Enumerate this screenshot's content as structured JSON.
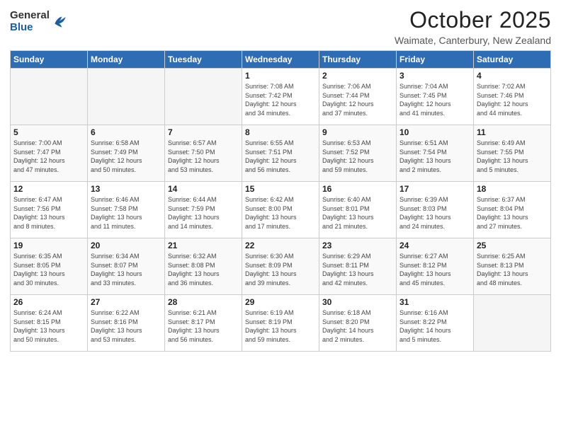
{
  "logo": {
    "general": "General",
    "blue": "Blue"
  },
  "header": {
    "title": "October 2025",
    "location": "Waimate, Canterbury, New Zealand"
  },
  "weekdays": [
    "Sunday",
    "Monday",
    "Tuesday",
    "Wednesday",
    "Thursday",
    "Friday",
    "Saturday"
  ],
  "weeks": [
    [
      {
        "day": "",
        "info": ""
      },
      {
        "day": "",
        "info": ""
      },
      {
        "day": "",
        "info": ""
      },
      {
        "day": "1",
        "info": "Sunrise: 7:08 AM\nSunset: 7:42 PM\nDaylight: 12 hours\nand 34 minutes."
      },
      {
        "day": "2",
        "info": "Sunrise: 7:06 AM\nSunset: 7:44 PM\nDaylight: 12 hours\nand 37 minutes."
      },
      {
        "day": "3",
        "info": "Sunrise: 7:04 AM\nSunset: 7:45 PM\nDaylight: 12 hours\nand 41 minutes."
      },
      {
        "day": "4",
        "info": "Sunrise: 7:02 AM\nSunset: 7:46 PM\nDaylight: 12 hours\nand 44 minutes."
      }
    ],
    [
      {
        "day": "5",
        "info": "Sunrise: 7:00 AM\nSunset: 7:47 PM\nDaylight: 12 hours\nand 47 minutes."
      },
      {
        "day": "6",
        "info": "Sunrise: 6:58 AM\nSunset: 7:49 PM\nDaylight: 12 hours\nand 50 minutes."
      },
      {
        "day": "7",
        "info": "Sunrise: 6:57 AM\nSunset: 7:50 PM\nDaylight: 12 hours\nand 53 minutes."
      },
      {
        "day": "8",
        "info": "Sunrise: 6:55 AM\nSunset: 7:51 PM\nDaylight: 12 hours\nand 56 minutes."
      },
      {
        "day": "9",
        "info": "Sunrise: 6:53 AM\nSunset: 7:52 PM\nDaylight: 12 hours\nand 59 minutes."
      },
      {
        "day": "10",
        "info": "Sunrise: 6:51 AM\nSunset: 7:54 PM\nDaylight: 13 hours\nand 2 minutes."
      },
      {
        "day": "11",
        "info": "Sunrise: 6:49 AM\nSunset: 7:55 PM\nDaylight: 13 hours\nand 5 minutes."
      }
    ],
    [
      {
        "day": "12",
        "info": "Sunrise: 6:47 AM\nSunset: 7:56 PM\nDaylight: 13 hours\nand 8 minutes."
      },
      {
        "day": "13",
        "info": "Sunrise: 6:46 AM\nSunset: 7:58 PM\nDaylight: 13 hours\nand 11 minutes."
      },
      {
        "day": "14",
        "info": "Sunrise: 6:44 AM\nSunset: 7:59 PM\nDaylight: 13 hours\nand 14 minutes."
      },
      {
        "day": "15",
        "info": "Sunrise: 6:42 AM\nSunset: 8:00 PM\nDaylight: 13 hours\nand 17 minutes."
      },
      {
        "day": "16",
        "info": "Sunrise: 6:40 AM\nSunset: 8:01 PM\nDaylight: 13 hours\nand 21 minutes."
      },
      {
        "day": "17",
        "info": "Sunrise: 6:39 AM\nSunset: 8:03 PM\nDaylight: 13 hours\nand 24 minutes."
      },
      {
        "day": "18",
        "info": "Sunrise: 6:37 AM\nSunset: 8:04 PM\nDaylight: 13 hours\nand 27 minutes."
      }
    ],
    [
      {
        "day": "19",
        "info": "Sunrise: 6:35 AM\nSunset: 8:05 PM\nDaylight: 13 hours\nand 30 minutes."
      },
      {
        "day": "20",
        "info": "Sunrise: 6:34 AM\nSunset: 8:07 PM\nDaylight: 13 hours\nand 33 minutes."
      },
      {
        "day": "21",
        "info": "Sunrise: 6:32 AM\nSunset: 8:08 PM\nDaylight: 13 hours\nand 36 minutes."
      },
      {
        "day": "22",
        "info": "Sunrise: 6:30 AM\nSunset: 8:09 PM\nDaylight: 13 hours\nand 39 minutes."
      },
      {
        "day": "23",
        "info": "Sunrise: 6:29 AM\nSunset: 8:11 PM\nDaylight: 13 hours\nand 42 minutes."
      },
      {
        "day": "24",
        "info": "Sunrise: 6:27 AM\nSunset: 8:12 PM\nDaylight: 13 hours\nand 45 minutes."
      },
      {
        "day": "25",
        "info": "Sunrise: 6:25 AM\nSunset: 8:13 PM\nDaylight: 13 hours\nand 48 minutes."
      }
    ],
    [
      {
        "day": "26",
        "info": "Sunrise: 6:24 AM\nSunset: 8:15 PM\nDaylight: 13 hours\nand 50 minutes."
      },
      {
        "day": "27",
        "info": "Sunrise: 6:22 AM\nSunset: 8:16 PM\nDaylight: 13 hours\nand 53 minutes."
      },
      {
        "day": "28",
        "info": "Sunrise: 6:21 AM\nSunset: 8:17 PM\nDaylight: 13 hours\nand 56 minutes."
      },
      {
        "day": "29",
        "info": "Sunrise: 6:19 AM\nSunset: 8:19 PM\nDaylight: 13 hours\nand 59 minutes."
      },
      {
        "day": "30",
        "info": "Sunrise: 6:18 AM\nSunset: 8:20 PM\nDaylight: 14 hours\nand 2 minutes."
      },
      {
        "day": "31",
        "info": "Sunrise: 6:16 AM\nSunset: 8:22 PM\nDaylight: 14 hours\nand 5 minutes."
      },
      {
        "day": "",
        "info": ""
      }
    ]
  ]
}
